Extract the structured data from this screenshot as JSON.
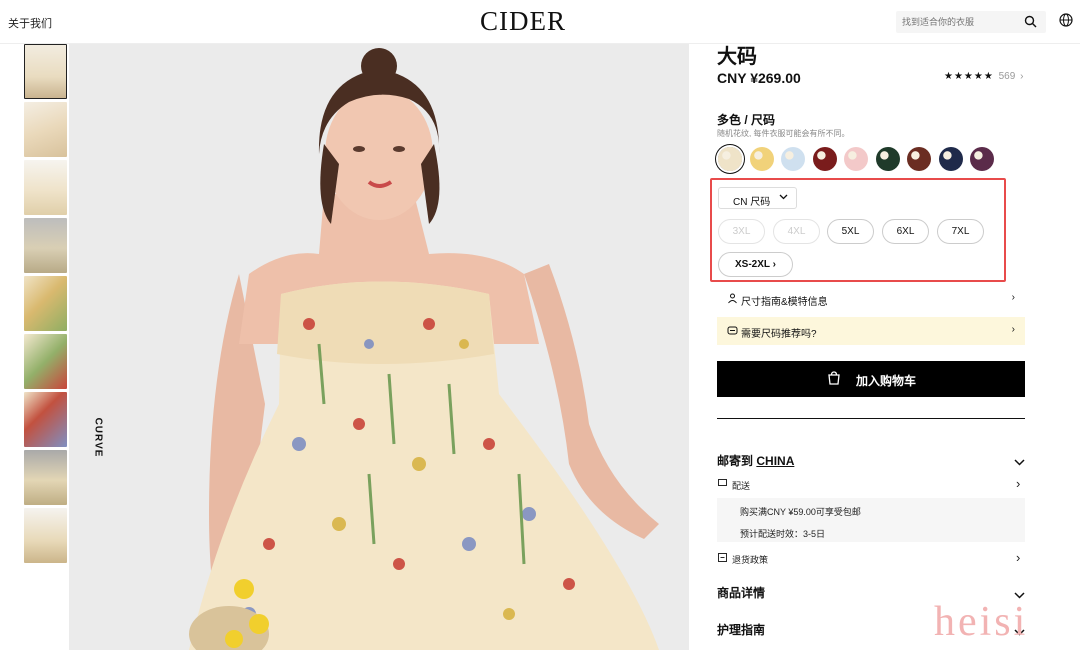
{
  "header": {
    "about_label": "关于我们",
    "logo": "CIDER",
    "search_placeholder": "找到适合你的衣服",
    "icons": [
      "search-icon",
      "globe-icon"
    ]
  },
  "gallery": {
    "thumb_count": 9,
    "curve_label": "CURVE"
  },
  "product": {
    "title": "大码",
    "price": "CNY ¥269.00",
    "rating_stars": "★★★★★",
    "rating_count": "569",
    "color_label": "多色 / 尺码",
    "color_note": "随机花纹, 每件衣服可能会有所不同。",
    "swatch_colors": [
      "#efe3c8",
      "#f1d27a",
      "#cfe0ef",
      "#7a1c1c",
      "#f3c9c9",
      "#1f3a2a",
      "#6b2d22",
      "#1f2a4a",
      "#5b2b4a"
    ],
    "size_system": "CN 尺码",
    "sizes": [
      {
        "label": "3XL",
        "available": false
      },
      {
        "label": "4XL",
        "available": false
      },
      {
        "label": "5XL",
        "available": true
      },
      {
        "label": "6XL",
        "available": true
      },
      {
        "label": "7XL",
        "available": true
      }
    ],
    "size_range_link": "XS-2XL",
    "size_guide": "尺寸指南&模特信息",
    "size_recommend": "需要尺码推荐吗?",
    "add_to_cart": "加入购物车"
  },
  "shipping": {
    "title_prefix": "邮寄到",
    "country": "CHINA",
    "delivery_label": "配送",
    "free_shipping": "购买满CNY ¥59.00可享受包邮",
    "eta": "预计配送时效：3-5日",
    "returns_label": "退货政策"
  },
  "sections": {
    "details": "商品详情",
    "care": "护理指南"
  },
  "watermark": "heisi"
}
